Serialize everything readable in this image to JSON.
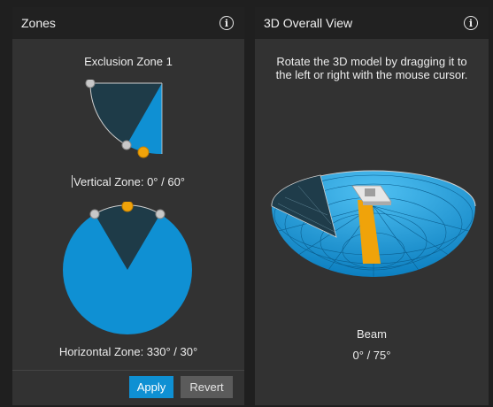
{
  "zones_panel": {
    "title": "Zones",
    "zone_name": "Exclusion Zone 1",
    "vertical_label": "Vertical Zone: 0° / 60°",
    "horizontal_label": "Horizontal Zone: 330° / 30°",
    "vertical_zone": {
      "start_deg": 0,
      "end_deg": 60
    },
    "horizontal_zone": {
      "start_deg": 330,
      "end_deg": 30
    },
    "apply_label": "Apply",
    "revert_label": "Revert"
  },
  "view_panel": {
    "title": "3D Overall View",
    "instruction": "Rotate the 3D model by dragging it to the left or right with the mouse cursor.",
    "beam_label": "Beam",
    "beam_value": "0° / 75°"
  },
  "colors": {
    "accent_blue": "#0f90d3",
    "zone_dark": "#1e3b48",
    "handle_orange": "#f0a30a",
    "handle_gray": "#c8c8c8",
    "panel_bg": "#323232",
    "header_bg": "#212121"
  },
  "icons": {
    "info": "info-circle-icon"
  }
}
